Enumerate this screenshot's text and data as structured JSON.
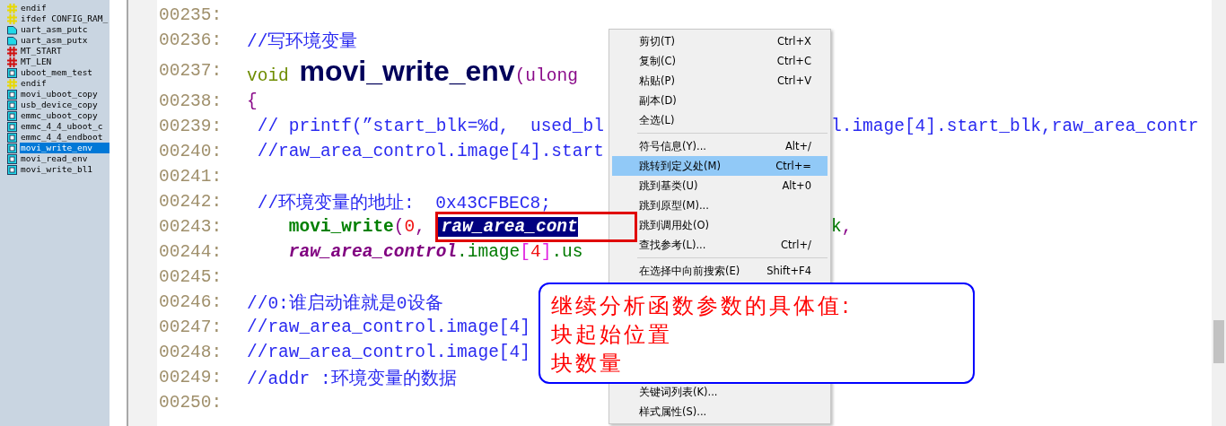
{
  "symbol_list": {
    "items": [
      {
        "label": "endif",
        "kind": "directive",
        "selected": false
      },
      {
        "label": "ifdef CONFIG_RAM_",
        "kind": "directive",
        "selected": false
      },
      {
        "label": "uart_asm_putc",
        "kind": "label",
        "selected": false
      },
      {
        "label": "uart_asm_putx",
        "kind": "label",
        "selected": false
      },
      {
        "label": "MT_START",
        "kind": "macro",
        "selected": false
      },
      {
        "label": "MT_LEN",
        "kind": "macro",
        "selected": false
      },
      {
        "label": "uboot_mem_test",
        "kind": "function",
        "selected": false
      },
      {
        "label": "endif",
        "kind": "directive",
        "selected": false
      },
      {
        "label": "movi_uboot_copy",
        "kind": "function",
        "selected": false
      },
      {
        "label": "usb_device_copy",
        "kind": "function",
        "selected": false
      },
      {
        "label": "emmc_uboot_copy",
        "kind": "function",
        "selected": false
      },
      {
        "label": "emmc_4_4_uboot_c",
        "kind": "function",
        "selected": false
      },
      {
        "label": "emmc_4_4_endboot",
        "kind": "function",
        "selected": false
      },
      {
        "label": "movi_write_env",
        "kind": "function",
        "selected": true
      },
      {
        "label": "movi_read_env",
        "kind": "function",
        "selected": false
      },
      {
        "label": "movi_write_bl1",
        "kind": "function",
        "selected": false
      }
    ]
  },
  "editor": {
    "lines": [
      {
        "number": "00235:"
      },
      {
        "number": "00236:",
        "segments": [
          {
            "kind": "comment",
            "text": "//写环境变量"
          }
        ]
      },
      {
        "number": "00237:",
        "segments": [
          {
            "kind": "keyword",
            "text": "void "
          },
          {
            "kind": "title",
            "text": "movi_write_env"
          },
          {
            "kind": "punct",
            "text": "(ulong"
          }
        ]
      },
      {
        "number": "00238:",
        "segments": [
          {
            "kind": "punct",
            "text": "{"
          }
        ]
      },
      {
        "number": "00239:",
        "segments": [
          {
            "kind": "comment",
            "text": " // printf(”start_blk=%d,  used_bl"
          }
        ],
        "right": [
          {
            "kind": "comment",
            "text": "l.image[4].start_blk,raw_area_contr"
          }
        ]
      },
      {
        "number": "00240:",
        "segments": [
          {
            "kind": "comment",
            "text": " //raw_area_control.image[4].start"
          }
        ]
      },
      {
        "number": "00241:"
      },
      {
        "number": "00242:",
        "segments": [
          {
            "kind": "comment",
            "text": " //环境变量的地址:  0x43CFBEC8;"
          }
        ]
      },
      {
        "number": "00243:",
        "segments": [
          {
            "kind": "call",
            "text": "    movi_write"
          },
          {
            "kind": "punct",
            "text": "("
          },
          {
            "kind": "number",
            "text": "0"
          },
          {
            "kind": "punct",
            "text": ", "
          },
          {
            "kind": "selection",
            "text": "raw_area_cont"
          }
        ],
        "right": [
          {
            "kind": "member",
            "text": "k"
          },
          {
            "kind": "punct",
            "text": ","
          }
        ]
      },
      {
        "number": "00244:",
        "segments": [
          {
            "kind": "param",
            "text": "    raw_area_control"
          },
          {
            "kind": "member",
            "text": ".image"
          },
          {
            "kind": "bracket",
            "text": "["
          },
          {
            "kind": "number",
            "text": "4"
          },
          {
            "kind": "bracket",
            "text": "]"
          },
          {
            "kind": "member",
            "text": ".us"
          }
        ]
      },
      {
        "number": "00245:"
      },
      {
        "number": "00246:",
        "segments": [
          {
            "kind": "comment",
            "text": "//0:谁启动谁就是0设备"
          }
        ]
      },
      {
        "number": "00247:",
        "segments": [
          {
            "kind": "comment",
            "text": "//raw_area_control.image[4]"
          }
        ]
      },
      {
        "number": "00248:",
        "segments": [
          {
            "kind": "comment",
            "text": "//raw_area_control.image[4]"
          }
        ]
      },
      {
        "number": "00249:",
        "segments": [
          {
            "kind": "comment",
            "text": "//addr :环境变量的数据"
          }
        ]
      },
      {
        "number": "00250:"
      }
    ]
  },
  "context_menu": {
    "upper_items": [
      {
        "kind": "item",
        "label": "剪切(T)",
        "shortcut": "Ctrl+X",
        "selected": false
      },
      {
        "kind": "item",
        "label": "复制(C)",
        "shortcut": "Ctrl+C",
        "selected": false
      },
      {
        "kind": "item",
        "label": "粘贴(P)",
        "shortcut": "Ctrl+V",
        "selected": false
      },
      {
        "kind": "item",
        "label": "副本(D)",
        "selected": false
      },
      {
        "kind": "item",
        "label": "全选(L)",
        "selected": false
      },
      {
        "kind": "separator"
      },
      {
        "kind": "item",
        "label": "符号信息(Y)...",
        "shortcut": "Alt+/",
        "selected": false
      },
      {
        "kind": "item",
        "label": "跳转到定义处(M)",
        "shortcut": "Ctrl+=",
        "selected": true
      },
      {
        "kind": "item",
        "label": "跳到基类(U)",
        "shortcut": "Alt+0",
        "selected": false
      },
      {
        "kind": "item",
        "label": "跳到原型(M)...",
        "selected": false
      },
      {
        "kind": "item",
        "label": "跳到调用处(O)",
        "selected": false
      },
      {
        "kind": "item",
        "label": "查找参考(L)...",
        "shortcut": "Ctrl+/",
        "selected": false
      },
      {
        "kind": "separator"
      },
      {
        "kind": "item",
        "label": "在选择中向前搜索(E)",
        "shortcut": "Shift+F4",
        "selected": false
      }
    ],
    "lower_items": [
      {
        "kind": "item",
        "label": "关键词列表(K)...",
        "selected": false
      },
      {
        "kind": "item",
        "label": "样式属性(S)...",
        "selected": false
      }
    ]
  },
  "callout": {
    "lines": [
      "继续分析函数参数的具体值:",
      "块起始位置",
      "块数量"
    ]
  }
}
